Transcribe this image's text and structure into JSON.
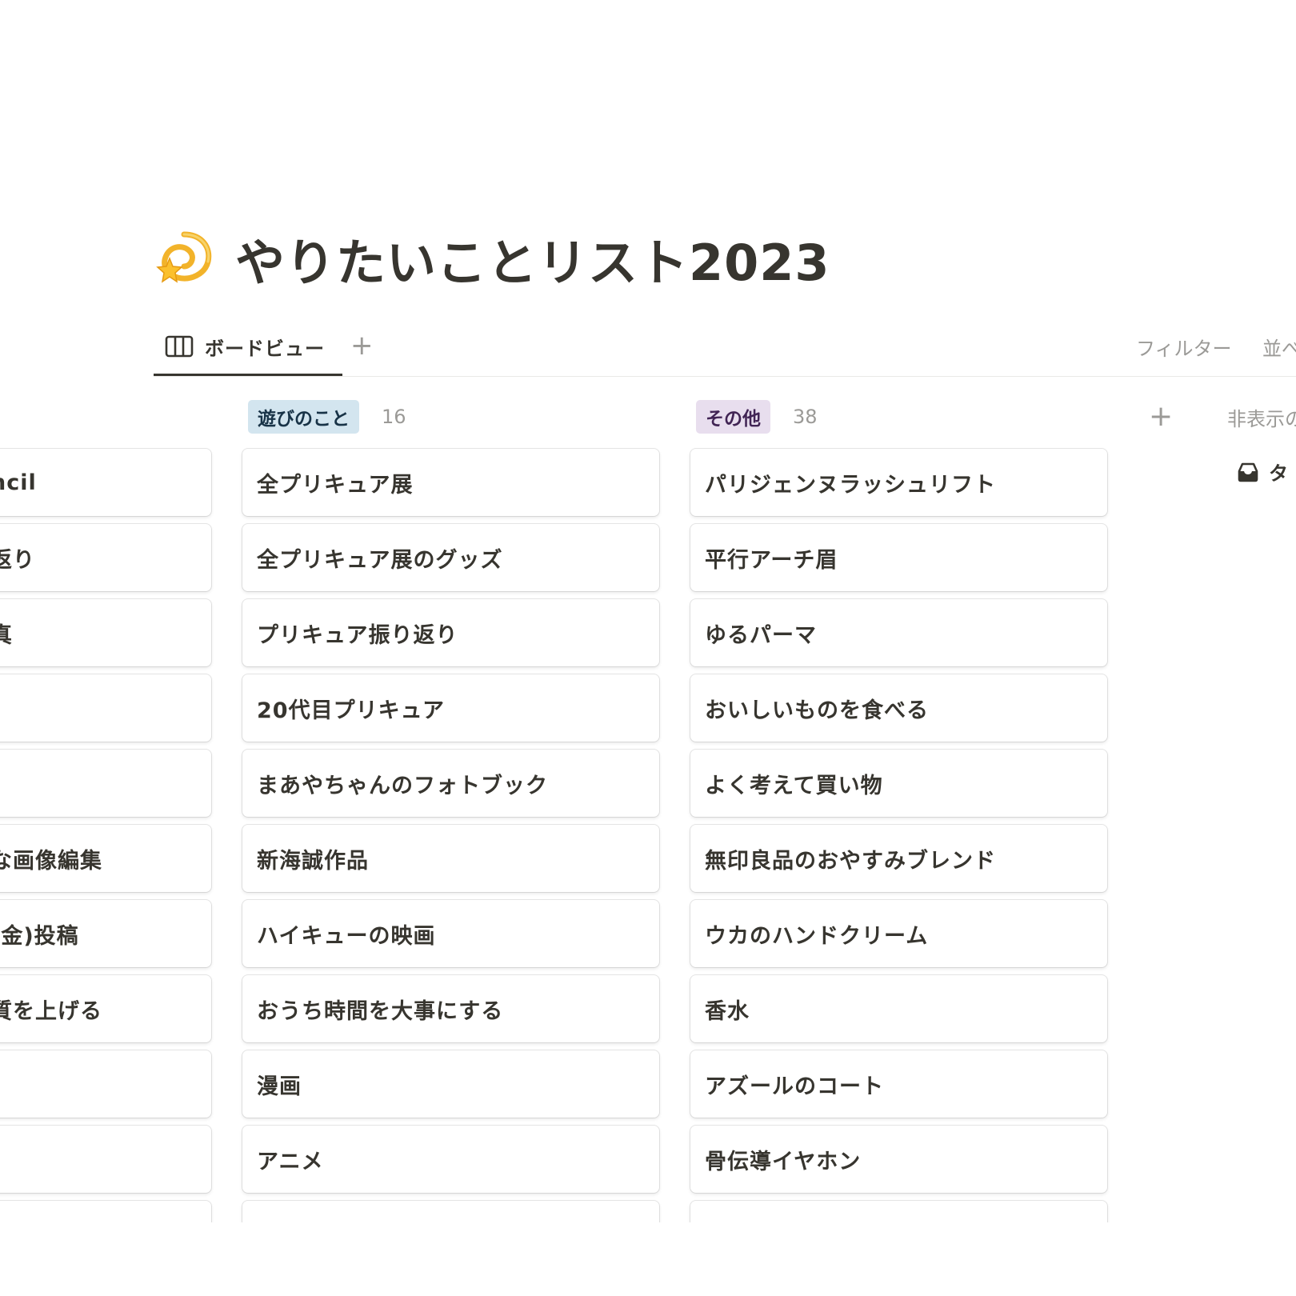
{
  "page": {
    "title": "やりたいことリスト2023",
    "icon": "dizzy-star-emoji"
  },
  "tabs": {
    "active_label": "ボードビュー",
    "active_icon": "board-columns-icon",
    "add_symbol": "+"
  },
  "toolbar": {
    "filter_label": "フィルター",
    "sort_label": "並べ"
  },
  "columns": {
    "left": {
      "items": [
        "ncil",
        "返り",
        "真",
        "",
        "",
        "な画像編集",
        "(金)投稿",
        "質を上げる",
        "",
        ""
      ]
    },
    "play": {
      "label": "遊びのこと",
      "count": "16",
      "tag_bg": "#d3e5ef",
      "tag_fg": "#183347",
      "items": [
        "全プリキュア展",
        "全プリキュア展のグッズ",
        "プリキュア振り返り",
        "20代目プリキュア",
        "まあやちゃんのフォトブック",
        "新海誠作品",
        "ハイキューの映画",
        "おうち時間を大事にする",
        "漫画",
        "アニメ"
      ]
    },
    "other": {
      "label": "その他",
      "count": "38",
      "tag_bg": "#e8deee",
      "tag_fg": "#412454",
      "items": [
        "パリジェンヌラッシュリフト",
        "平行アーチ眉",
        "ゆるパーマ",
        "おいしいものを食べる",
        "よく考えて買い物",
        "無印良品のおやすみブレンド",
        "ウカのハンドクリーム",
        "香水",
        "アズールのコート",
        "骨伝導イヤホン"
      ]
    }
  },
  "board": {
    "add_group_symbol": "+",
    "hidden_groups_label": "非表示の",
    "hidden_item_label": "タ",
    "hidden_item_icon": "inbox-tray-icon"
  }
}
